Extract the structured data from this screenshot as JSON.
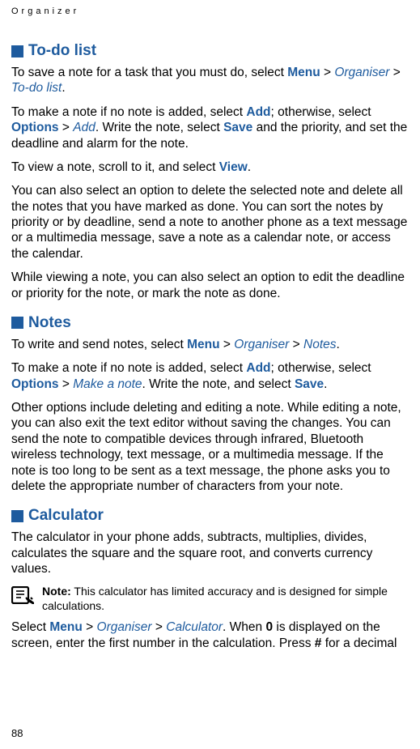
{
  "header": "Organizer",
  "pageNumber": "88",
  "sections": {
    "todo": {
      "title": "To-do list",
      "p1": {
        "t1": "To save a note for a task that you must do, select ",
        "menu": "Menu",
        "gt1": " > ",
        "organiser": "Organiser",
        "gt2": " > ",
        "todolist": "To-do list",
        "t2": "."
      },
      "p2": {
        "t1": "To make a note if no note is added, select ",
        "add": "Add",
        "t2": "; otherwise, select ",
        "options": "Options",
        "gt1": " > ",
        "addItalic": "Add",
        "t3": ". Write the note, select ",
        "save": "Save",
        "t4": " and the priority, and set the deadline and alarm for the note."
      },
      "p3": {
        "t1": "To view a note, scroll to it, and select ",
        "view": "View",
        "t2": "."
      },
      "p4": "You can also select an option to delete the selected note and delete all the notes that you have marked as done. You can sort the notes by priority or by deadline, send a note to another phone as a text message or a multimedia message, save a note as a calendar note, or access the calendar.",
      "p5": "While viewing a note, you can also select an option to edit the deadline or priority for the note, or mark the note as done."
    },
    "notes": {
      "title": "Notes",
      "p1": {
        "t1": "To write and send notes, select ",
        "menu": "Menu",
        "gt1": " > ",
        "organiser": "Organiser",
        "gt2": " > ",
        "notesItalic": "Notes",
        "t2": "."
      },
      "p2": {
        "t1": "To make a note if no note is added, select ",
        "add": "Add",
        "t2": "; otherwise, select ",
        "options": "Options",
        "gt1": " > ",
        "makeNote": "Make a note",
        "t3": ". Write the note, and select ",
        "save": "Save",
        "t4": "."
      },
      "p3": "Other options include deleting and editing a note. While editing a note, you can also exit the text editor without saving the changes. You can send the note to compatible devices through infrared, Bluetooth wireless technology, text message, or a multimedia message. If the note is too long to be sent as a text message, the phone asks you to delete the appropriate number of characters from your note."
    },
    "calculator": {
      "title": "Calculator",
      "p1": "The calculator in your phone adds, subtracts, multiplies, divides, calculates the square and the square root, and converts currency values.",
      "note": {
        "label": "Note:",
        "text": " This calculator has limited accuracy and is designed for simple calculations."
      },
      "p2": {
        "t1": "Select ",
        "menu": "Menu",
        "gt1": " > ",
        "organiser": "Organiser",
        "gt2": " > ",
        "calculator": "Calculator",
        "t2": ". When ",
        "zero": "0",
        "t3": " is displayed on the screen, enter the first number in the calculation. Press ",
        "hash": "#",
        "t4": " for a decimal"
      }
    }
  }
}
